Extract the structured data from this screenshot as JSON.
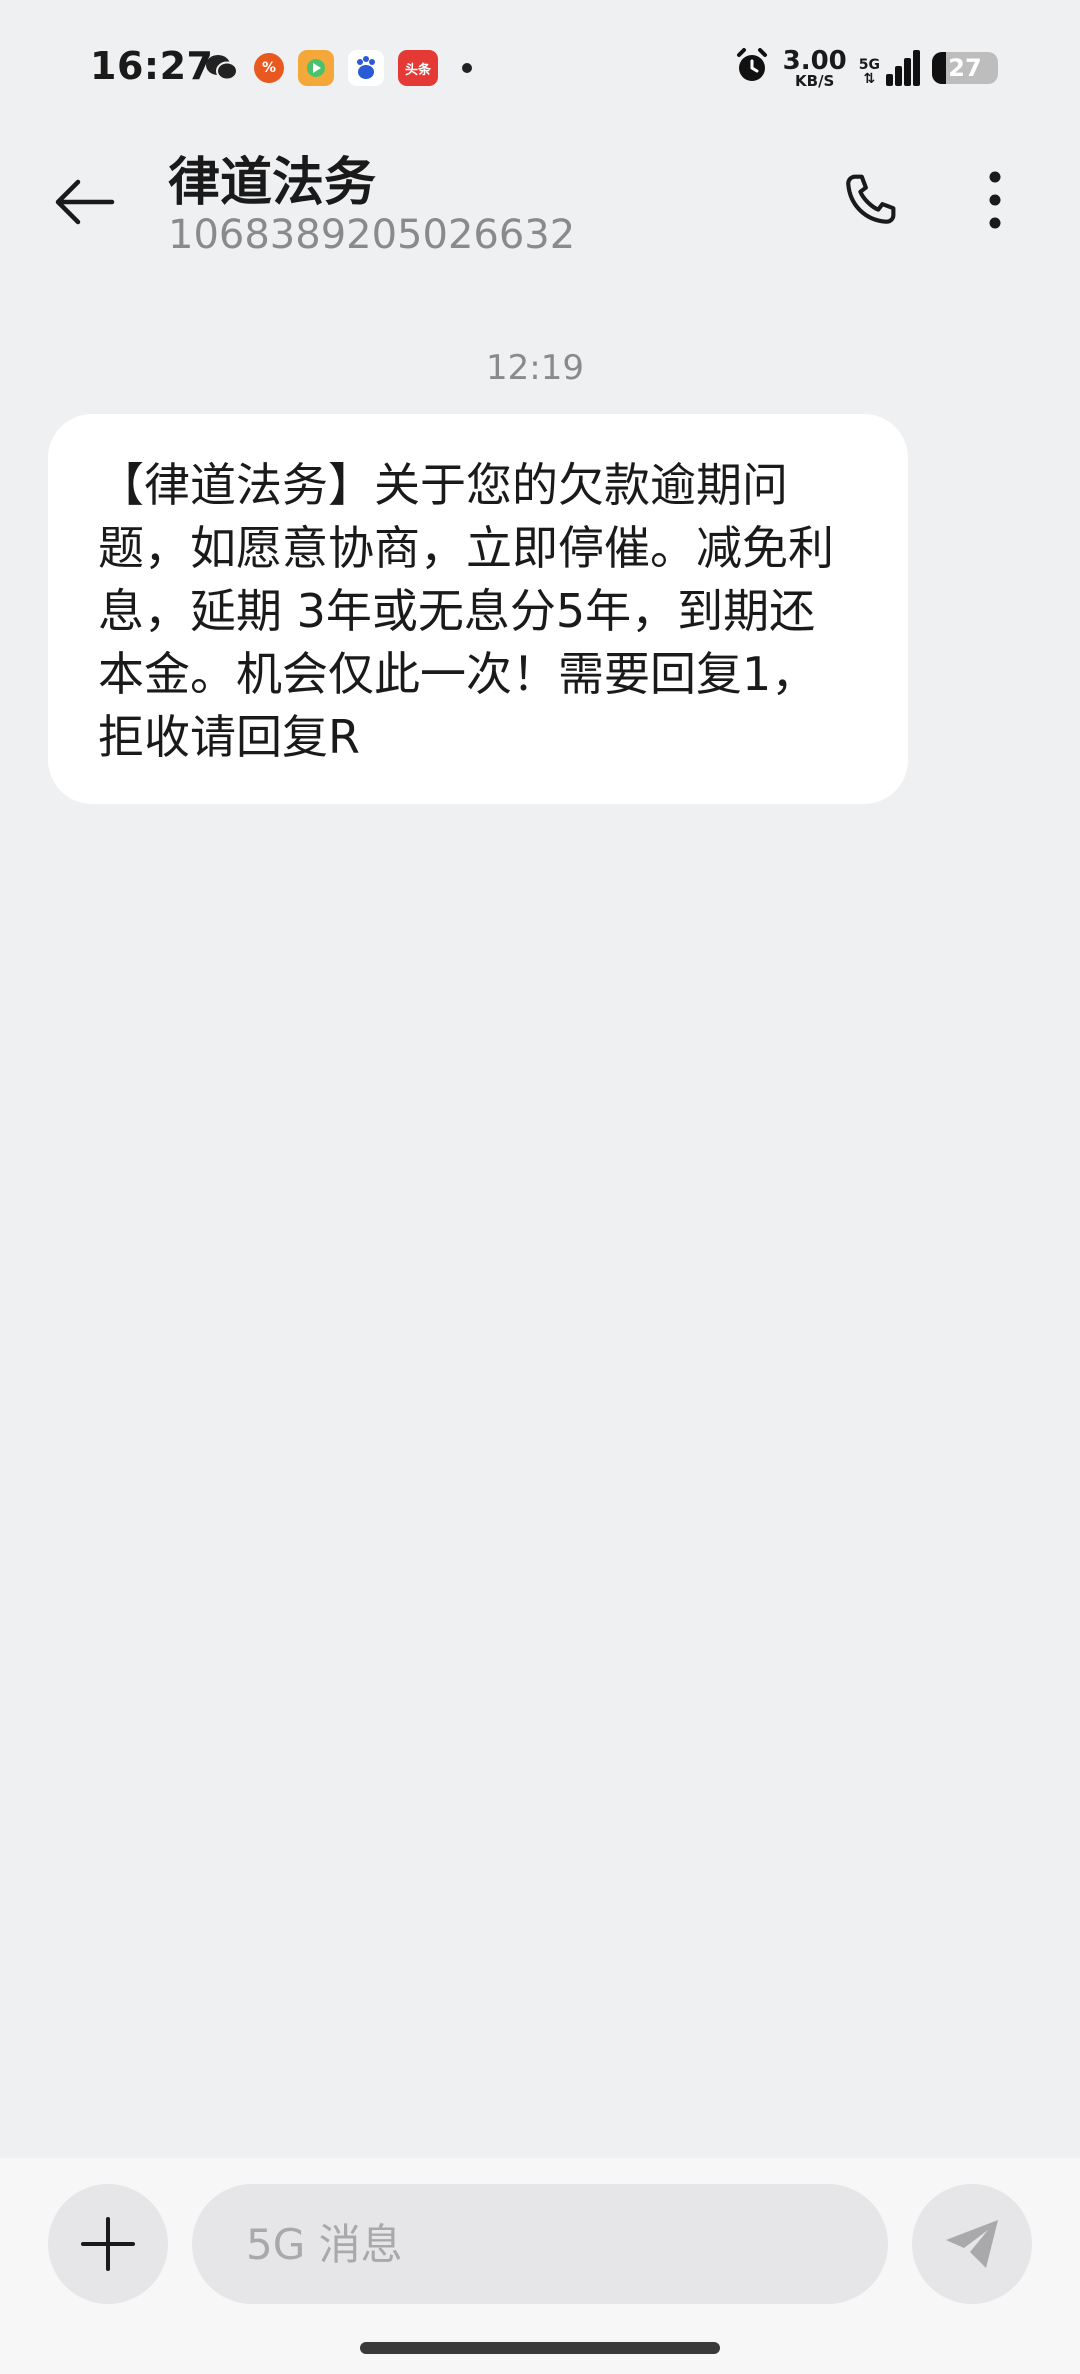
{
  "status_bar": {
    "time": "16:27",
    "net_speed": "3.00",
    "net_unit": "KB/S",
    "signal_label": "5G",
    "battery": "27",
    "app_icons": [
      "wechat-icon",
      "app-orange-icon",
      "video-app-icon",
      "baidu-icon",
      "toutiao-icon"
    ],
    "toutiao_label": "头条"
  },
  "header": {
    "contact_name": "律道法务",
    "contact_number": "1068389205026632"
  },
  "conversation": {
    "timestamp": "12:19",
    "messages": [
      {
        "text": "【律道法务】关于您的欠款逾期问题，如愿意协商，立即停催。减免利息，延期 3年或无息分5年，到期还本金。机会仅此一次！需要回复1，拒收请回复R"
      }
    ]
  },
  "composer": {
    "placeholder": "5G 消息"
  },
  "colors": {
    "background": "#eff0f2",
    "bubble": "#ffffff",
    "secondary_text": "#8a8a8a"
  }
}
